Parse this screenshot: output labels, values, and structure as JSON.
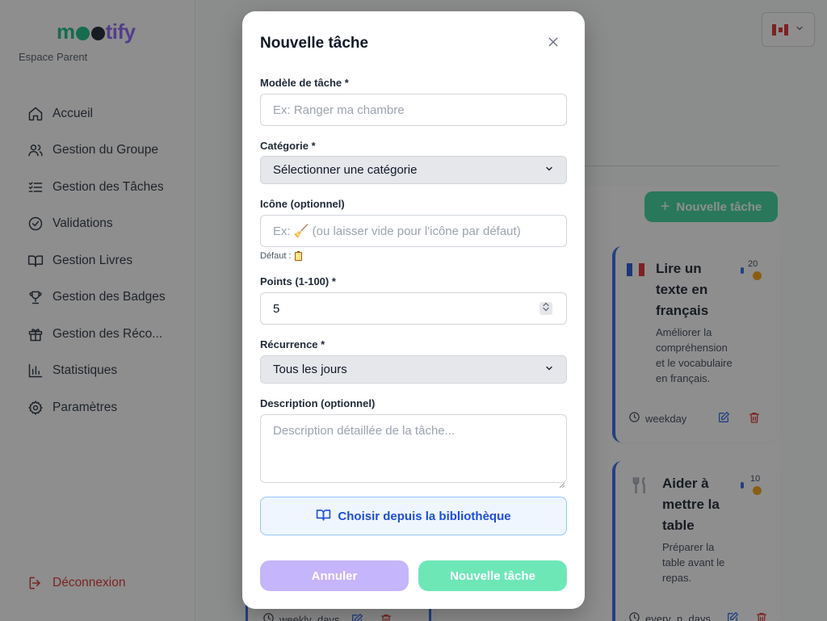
{
  "brand": {
    "logo_prefix": "m",
    "logo_suffix": "tify",
    "subtitle": "Espace Parent"
  },
  "sidebar": {
    "items": [
      {
        "label": "Accueil",
        "icon": "home-icon"
      },
      {
        "label": "Gestion du Groupe",
        "icon": "users-icon"
      },
      {
        "label": "Gestion des Tâches",
        "icon": "list-checks-icon"
      },
      {
        "label": "Validations",
        "icon": "check-circle-icon"
      },
      {
        "label": "Gestion Livres",
        "icon": "book-open-icon"
      },
      {
        "label": "Gestion des Badges",
        "icon": "trophy-icon"
      },
      {
        "label": "Gestion des Réco...",
        "icon": "gift-icon"
      },
      {
        "label": "Statistiques",
        "icon": "bar-chart-icon"
      },
      {
        "label": "Paramètres",
        "icon": "gear-icon"
      }
    ],
    "logout": "Déconnexion"
  },
  "header": {
    "language_flag": "canada-flag-icon"
  },
  "background": {
    "new_task_button": "Nouvelle tâche",
    "cards": [
      {
        "title_lines": [
          "Lire un",
          "texte en",
          "français"
        ],
        "description_lines": [
          "Améliorer la",
          "compréhension",
          "et le vocabulaire",
          "en français."
        ],
        "points": "20",
        "recurrence": "weekday",
        "icon": "france-flag-icon"
      },
      {
        "title_lines": [
          "Aider à",
          "mettre la",
          "table"
        ],
        "description_lines": [
          "Préparer la",
          "table avant le",
          "repas."
        ],
        "points": "10",
        "recurrence": "every_n_days",
        "icon": "fork-knife-icon"
      }
    ],
    "left_card_recurrence": "weekly_days"
  },
  "modal": {
    "title": "Nouvelle tâche",
    "fields": {
      "template": {
        "label": "Modèle de tâche *",
        "placeholder": "Ex: Ranger ma chambre",
        "value": ""
      },
      "category": {
        "label": "Catégorie *",
        "value": "Sélectionner une catégorie"
      },
      "icon": {
        "label": "Icône (optionnel)",
        "placeholder": "Ex: 🧹 (ou laisser vide pour l'icône par défaut)",
        "default_label": "Défaut :",
        "default_icon": "clipboard-icon"
      },
      "points": {
        "label": "Points (1-100) *",
        "value": "5"
      },
      "recurrence": {
        "label": "Récurrence *",
        "value": "Tous les jours"
      },
      "description": {
        "label": "Description (optionnel)",
        "placeholder": "Description détaillée de la tâche..."
      }
    },
    "library_button": "Choisir depuis la bibliothèque",
    "cancel_button": "Annuler",
    "submit_button": "Nouvelle tâche"
  },
  "colors": {
    "brand_green": "#10b981",
    "brand_purple": "#8b5cf6",
    "accent_blue": "#2563eb",
    "danger": "#dc2626",
    "cancel_bg": "#c4b5fd",
    "submit_bg": "#6ee7b7"
  }
}
